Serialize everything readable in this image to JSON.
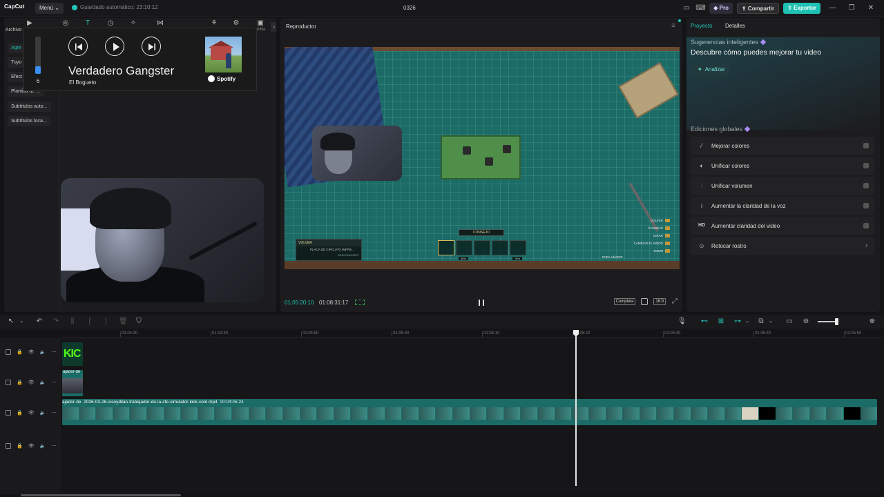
{
  "titlebar": {
    "logo": "CapCut",
    "menu_label": "Menú",
    "autosave": "Guardado automático: 23:10:12",
    "project_name": "0326",
    "pro_label": "Pro",
    "share_label": "Compartir",
    "export_label": "Exportar"
  },
  "left_panel": {
    "archivo_label": "Archivo",
    "corner_label": "ntilla",
    "sidebar": [
      "Agre",
      "Tuyo",
      "Efect",
      "Plantilla de ...",
      "Subtítulos auto...",
      "Subtítulos loca..."
    ]
  },
  "media_overlay": {
    "volume_value": "6",
    "volume_level": 0.2,
    "song_title": "Verdadero Gangster",
    "artist": "El Bogueto",
    "service": "Spotify"
  },
  "player": {
    "title": "Reproductor",
    "current_time": "01:05:20:10",
    "total_time": "01:08:31:17",
    "complete_label": "Completa",
    "ratio_label": "16:9",
    "hud": {
      "volver": "VOLVER",
      "placa": "PLACA DE CIRCUITO IMPRE...",
      "desconocido": "DESCONOCIDO",
      "consejo": "CONSEJO",
      "pct1": "30%",
      "pct2": "78%",
      "right_controls": [
        "VOLVER",
        "CONSEJO",
        "GIRAR",
        "CAMBIAR EL MODO",
        "ZOOM"
      ],
      "add_label": "PARA AÑADIR"
    }
  },
  "right_panel": {
    "tabs": [
      "Proyecto",
      "Detalles"
    ],
    "smart_title": "Sugerencias inteligentes",
    "smart_subtitle": "Descubre cómo puedes mejorar tu video",
    "analyze_label": "Analizar",
    "global_title": "Ediciones globales",
    "global_items": [
      {
        "label": "Mejorar colores",
        "icon": "wand-icon"
      },
      {
        "label": "Unificar colores",
        "icon": "palette-icon"
      },
      {
        "label": "Unificar volumen",
        "icon": "equalizer-icon"
      },
      {
        "label": "Aumentar la claridad de la voz",
        "icon": "waveform-icon"
      },
      {
        "label": "Aumentar claridad del video",
        "icon": "hd-icon"
      },
      {
        "label": "Retocar rostro",
        "icon": "face-icon"
      }
    ]
  },
  "ruler": {
    "labels": [
      "01:04:30",
      "01:04:40",
      "01:04:50",
      "01:05:00",
      "01:05:10",
      "01:05:20",
      "01:05:30",
      "01:05:40",
      "01:05:50"
    ]
  },
  "tracks": {
    "kick_text": "KIC",
    "small_clip_label": "ajador-de",
    "main_clip_prefix": "ajador-de",
    "main_clip_name": "2026-03-26-sisoydilan-trabajador-de-la-cfe-simulator-kick-com.mp4",
    "main_clip_duration": "00:04:05:24"
  },
  "colors": {
    "accent": "#22c3b8",
    "export": "#1fc1b3",
    "clip": "#1b6b66",
    "kick_green": "#53fc18"
  }
}
